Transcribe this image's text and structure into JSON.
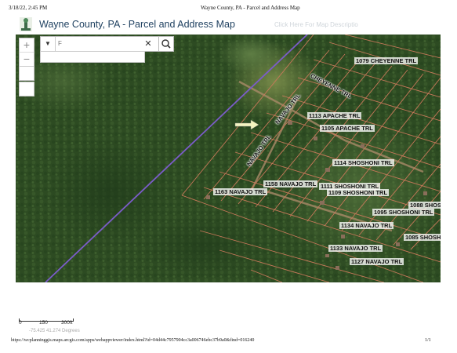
{
  "print_header": {
    "datetime": "3/18/22, 2:45 PM",
    "page_title": "Wayne County, PA - Parcel and Address Map"
  },
  "app": {
    "title": "Wayne County, PA - Parcel and Address Map",
    "description_link": "Click Here For Map Descriptio"
  },
  "map_controls": {
    "zoom_in": "+",
    "zoom_out": "−",
    "search_placeholder": "F",
    "search_dropdown": "▼",
    "clear": "✕"
  },
  "colors": {
    "forest": "#2f4f24",
    "parcel_lines": "#c8785a",
    "boundary": "#7b5cc9",
    "title": "#1d3f5f"
  },
  "icons": [
    "county-logo-icon",
    "search-icon",
    "arrow-marker-icon"
  ],
  "street_labels": [
    "1079 CHEYENNE TRL",
    "CHEYENNE TRL",
    "NAVAJO TRL",
    "1113 APACHE TRL",
    "1105 APACHE TRL",
    "NAVAJO TRL",
    "1114 SHOSHONI TRL",
    "1158 NAVAJO TRL",
    "1111 SHOSHONI TRL",
    "1109 SHOSHONI TRL",
    "1163 NAVAJO TRL",
    "1088 SHOS",
    "1095 SHOSHONI TRL",
    "1134 NAVAJO TRL",
    "1085 SHOSH",
    "1133 NAVAJO TRL",
    "1127 NAVAJO TRL"
  ],
  "scale": {
    "tick_0": "0",
    "tick_1": "150",
    "tick_2": "300ft",
    "coordinates": "-75.425 41.274 Degrees"
  },
  "print_footer": {
    "url": "https://wcplanninggis.maps.arcgis.com/apps/webappviewer/index.html?id=04d44c7957904cc3a006746ebc37b9a0&find=016240",
    "page": "1/1"
  }
}
